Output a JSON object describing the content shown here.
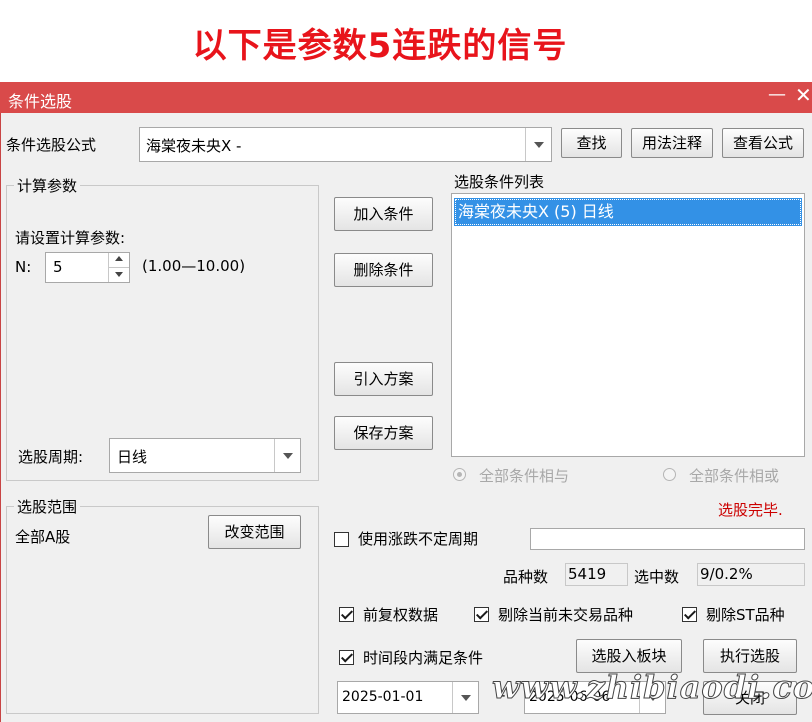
{
  "headline": "以下是参数5连跌的信号",
  "window": {
    "title": "条件选股",
    "minimize": "—",
    "close": "✕"
  },
  "formula": {
    "label": "条件选股公式",
    "value": "海棠夜未央X  -",
    "find": "查找",
    "usage": "用法注释",
    "view": "查看公式"
  },
  "params": {
    "group": "计算参数",
    "prompt": "请设置计算参数:",
    "n_label": "N:",
    "n_value": "5",
    "range": "(1.00—10.00)"
  },
  "period": {
    "label": "选股周期:",
    "value": "日线"
  },
  "scope": {
    "group": "选股范围",
    "value": "全部A股",
    "change": "改变范围"
  },
  "actions": {
    "add": "加入条件",
    "remove": "删除条件",
    "import": "引入方案",
    "save": "保存方案"
  },
  "conditions": {
    "title": "选股条件列表",
    "items": [
      "海棠夜未央X (5) 日线"
    ]
  },
  "logic": {
    "and_label": "全部条件相与",
    "or_label": "全部条件相或"
  },
  "status": {
    "text": "选股完毕.",
    "color": "#cc0000"
  },
  "uncertain_period": {
    "label": "使用涨跌不定周期",
    "value": ""
  },
  "stats": {
    "count_label": "品种数",
    "count_value": "5419",
    "selected_label": "选中数",
    "selected_value": "9/0.2%"
  },
  "options": {
    "adjusted": "前复权数据",
    "exclude_untraded": "剔除当前未交易品种",
    "exclude_st": "剔除ST品种",
    "time_range": "时间段内满足条件"
  },
  "buttons": {
    "to_block": "选股入板块",
    "execute": "执行选股",
    "close": "关闭"
  },
  "dates": {
    "start": "2025-01-01",
    "separator": "-",
    "end": "2025-06-06"
  },
  "watermark": "www.zhibiaodi.com"
}
